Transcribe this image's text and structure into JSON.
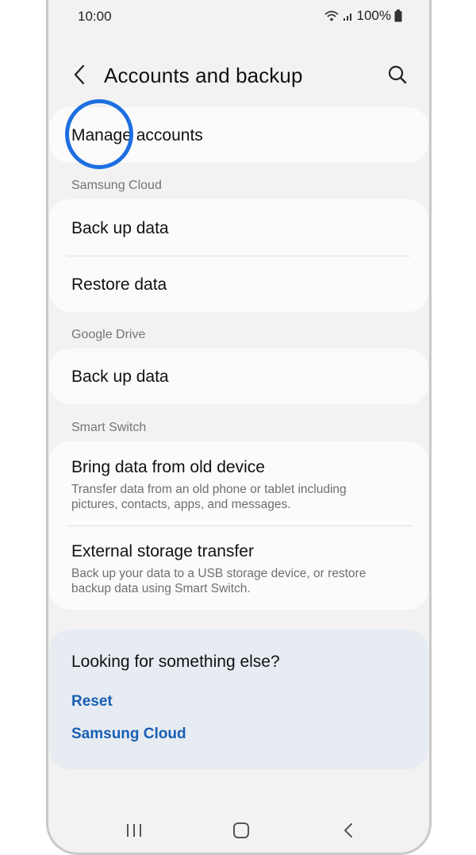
{
  "status_bar": {
    "time": "10:00",
    "battery": "100%",
    "icons": [
      "wifi-icon",
      "signal-icon",
      "battery-icon"
    ]
  },
  "header": {
    "title": "Accounts and backup",
    "back_icon": "chevron-left-icon",
    "search_icon": "search-icon"
  },
  "manage_accounts": {
    "label": "Manage accounts"
  },
  "sections": {
    "samsung_cloud": {
      "label": "Samsung Cloud",
      "items": [
        {
          "title": "Back up data"
        },
        {
          "title": "Restore data"
        }
      ]
    },
    "google_drive": {
      "label": "Google Drive",
      "items": [
        {
          "title": "Back up data"
        }
      ]
    },
    "smart_switch": {
      "label": "Smart Switch",
      "items": [
        {
          "title": "Bring data from old device",
          "desc_line1": "Transfer data from an old phone or tablet including",
          "desc_line2": "pictures, contacts, apps, and messages."
        },
        {
          "title": "External storage transfer",
          "desc_line1": "Back up your data to a USB storage device, or restore",
          "desc_line2": "backup data using Smart Switch."
        }
      ]
    }
  },
  "suggestions": {
    "title": "Looking for something else?",
    "links": [
      "Reset",
      "Samsung Cloud"
    ]
  },
  "nav_bar": {
    "icons": [
      "recents-icon",
      "home-icon",
      "back-icon"
    ]
  },
  "colors": {
    "link": "#1a5fb4",
    "highlight": "#1d6fe0",
    "background": "#f2f2f2",
    "card": "#fbfbfb",
    "suggestion_bg": "#e6ecf2"
  }
}
